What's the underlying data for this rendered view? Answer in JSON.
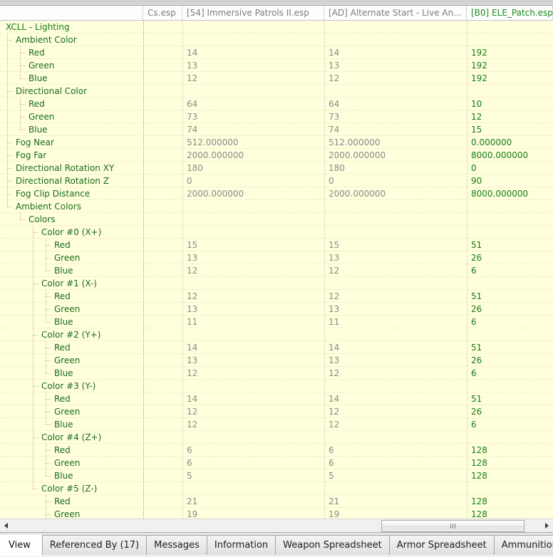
{
  "window": {
    "type": "record-comparison-grid"
  },
  "columns": [
    {
      "label": "",
      "key": "tree",
      "active": false
    },
    {
      "label": "Cs.esp",
      "key": "c1",
      "active": false
    },
    {
      "label": "[54] Immersive Patrols II.esp",
      "key": "c2",
      "active": false
    },
    {
      "label": "[AD] Alternate Start - Live An...",
      "key": "c3",
      "active": false
    },
    {
      "label": "[B0] ELE_Patch.esp",
      "key": "c4",
      "active": true
    }
  ],
  "rows": [
    {
      "label": "XCLL - Lighting",
      "depth": 0,
      "last": false,
      "c1": "",
      "c2": "",
      "c3": "",
      "c4": ""
    },
    {
      "label": "Ambient Color",
      "depth": 1,
      "last": false,
      "c1": "",
      "c2": "",
      "c3": "",
      "c4": ""
    },
    {
      "label": "Red",
      "depth": 2,
      "last": false,
      "c1": "",
      "c2": "14",
      "c3": "14",
      "c4": "192"
    },
    {
      "label": "Green",
      "depth": 2,
      "last": false,
      "c1": "",
      "c2": "13",
      "c3": "13",
      "c4": "192"
    },
    {
      "label": "Blue",
      "depth": 2,
      "last": true,
      "c1": "",
      "c2": "12",
      "c3": "12",
      "c4": "192"
    },
    {
      "label": "Directional Color",
      "depth": 1,
      "last": false,
      "c1": "",
      "c2": "",
      "c3": "",
      "c4": ""
    },
    {
      "label": "Red",
      "depth": 2,
      "last": false,
      "c1": "",
      "c2": "64",
      "c3": "64",
      "c4": "10"
    },
    {
      "label": "Green",
      "depth": 2,
      "last": false,
      "c1": "",
      "c2": "73",
      "c3": "73",
      "c4": "12"
    },
    {
      "label": "Blue",
      "depth": 2,
      "last": true,
      "c1": "",
      "c2": "74",
      "c3": "74",
      "c4": "15"
    },
    {
      "label": "Fog Near",
      "depth": 1,
      "last": false,
      "c1": "",
      "c2": "512.000000",
      "c3": "512.000000",
      "c4": "0.000000"
    },
    {
      "label": "Fog Far",
      "depth": 1,
      "last": false,
      "c1": "",
      "c2": "2000.000000",
      "c3": "2000.000000",
      "c4": "8000.000000"
    },
    {
      "label": "Directional Rotation XY",
      "depth": 1,
      "last": false,
      "c1": "",
      "c2": "180",
      "c3": "180",
      "c4": "0"
    },
    {
      "label": "Directional Rotation Z",
      "depth": 1,
      "last": false,
      "c1": "",
      "c2": "0",
      "c3": "0",
      "c4": "90"
    },
    {
      "label": "Fog Clip Distance",
      "depth": 1,
      "last": false,
      "c1": "",
      "c2": "2000.000000",
      "c3": "2000.000000",
      "c4": "8000.000000"
    },
    {
      "label": "Ambient Colors",
      "depth": 1,
      "last": true,
      "c1": "",
      "c2": "",
      "c3": "",
      "c4": ""
    },
    {
      "label": "Colors",
      "depth": 2,
      "last": true,
      "c1": "",
      "c2": "",
      "c3": "",
      "c4": ""
    },
    {
      "label": "Color #0 (X+)",
      "depth": 3,
      "last": false,
      "c1": "",
      "c2": "",
      "c3": "",
      "c4": ""
    },
    {
      "label": "Red",
      "depth": 4,
      "last": false,
      "c1": "",
      "c2": "15",
      "c3": "15",
      "c4": "51"
    },
    {
      "label": "Green",
      "depth": 4,
      "last": false,
      "c1": "",
      "c2": "13",
      "c3": "13",
      "c4": "26"
    },
    {
      "label": "Blue",
      "depth": 4,
      "last": true,
      "c1": "",
      "c2": "12",
      "c3": "12",
      "c4": "6"
    },
    {
      "label": "Color #1 (X-)",
      "depth": 3,
      "last": false,
      "c1": "",
      "c2": "",
      "c3": "",
      "c4": ""
    },
    {
      "label": "Red",
      "depth": 4,
      "last": false,
      "c1": "",
      "c2": "12",
      "c3": "12",
      "c4": "51"
    },
    {
      "label": "Green",
      "depth": 4,
      "last": false,
      "c1": "",
      "c2": "13",
      "c3": "13",
      "c4": "26"
    },
    {
      "label": "Blue",
      "depth": 4,
      "last": true,
      "c1": "",
      "c2": "11",
      "c3": "11",
      "c4": "6"
    },
    {
      "label": "Color #2 (Y+)",
      "depth": 3,
      "last": false,
      "c1": "",
      "c2": "",
      "c3": "",
      "c4": ""
    },
    {
      "label": "Red",
      "depth": 4,
      "last": false,
      "c1": "",
      "c2": "14",
      "c3": "14",
      "c4": "51"
    },
    {
      "label": "Green",
      "depth": 4,
      "last": false,
      "c1": "",
      "c2": "13",
      "c3": "13",
      "c4": "26"
    },
    {
      "label": "Blue",
      "depth": 4,
      "last": true,
      "c1": "",
      "c2": "12",
      "c3": "12",
      "c4": "6"
    },
    {
      "label": "Color #3 (Y-)",
      "depth": 3,
      "last": false,
      "c1": "",
      "c2": "",
      "c3": "",
      "c4": ""
    },
    {
      "label": "Red",
      "depth": 4,
      "last": false,
      "c1": "",
      "c2": "14",
      "c3": "14",
      "c4": "51"
    },
    {
      "label": "Green",
      "depth": 4,
      "last": false,
      "c1": "",
      "c2": "12",
      "c3": "12",
      "c4": "26"
    },
    {
      "label": "Blue",
      "depth": 4,
      "last": true,
      "c1": "",
      "c2": "12",
      "c3": "12",
      "c4": "6"
    },
    {
      "label": "Color #4 (Z+)",
      "depth": 3,
      "last": false,
      "c1": "",
      "c2": "",
      "c3": "",
      "c4": ""
    },
    {
      "label": "Red",
      "depth": 4,
      "last": false,
      "c1": "",
      "c2": "6",
      "c3": "6",
      "c4": "128"
    },
    {
      "label": "Green",
      "depth": 4,
      "last": false,
      "c1": "",
      "c2": "6",
      "c3": "6",
      "c4": "128"
    },
    {
      "label": "Blue",
      "depth": 4,
      "last": true,
      "c1": "",
      "c2": "5",
      "c3": "5",
      "c4": "128"
    },
    {
      "label": "Color #5 (Z-)",
      "depth": 3,
      "last": true,
      "c1": "",
      "c2": "",
      "c3": "",
      "c4": ""
    },
    {
      "label": "Red",
      "depth": 4,
      "last": false,
      "c1": "",
      "c2": "21",
      "c3": "21",
      "c4": "128"
    },
    {
      "label": "Green",
      "depth": 4,
      "last": false,
      "c1": "",
      "c2": "19",
      "c3": "19",
      "c4": "128"
    }
  ],
  "scrollbar": {
    "left_arrow": "◀",
    "right_arrow": "▶",
    "grip": "|||"
  },
  "tabs": [
    {
      "label": "View",
      "active": true
    },
    {
      "label": "Referenced By (17)",
      "active": false
    },
    {
      "label": "Messages",
      "active": false
    },
    {
      "label": "Information",
      "active": false
    },
    {
      "label": "Weapon Spreadsheet",
      "active": false
    },
    {
      "label": "Armor Spreadsheet",
      "active": false
    },
    {
      "label": "Ammunition Spreadsheet",
      "active": false
    }
  ],
  "colors": {
    "grid_background": "#ffffdd",
    "tree_text": "#1a6b1a",
    "value_text": "#8a8a8a",
    "active_value_text": "#157d15",
    "header_text": "#7c7c7c"
  }
}
